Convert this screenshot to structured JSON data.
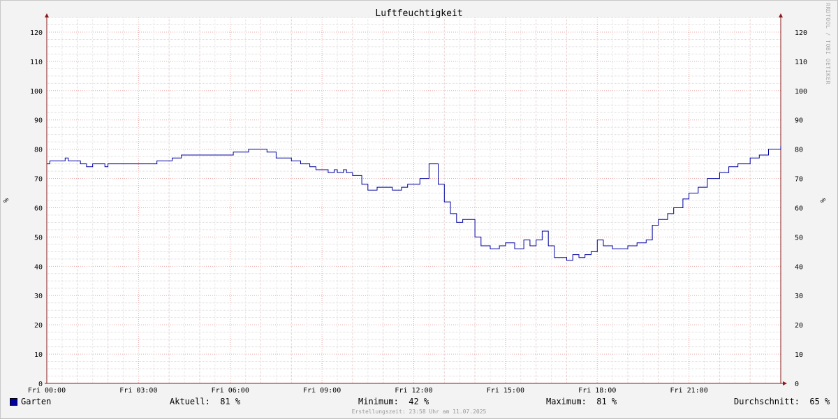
{
  "chart_data": {
    "type": "line",
    "title": "Luftfeuchtigkeit",
    "ylabel": "%",
    "ylabel_right": "%",
    "ylim": [
      0,
      125
    ],
    "y_ticks": [
      0,
      10,
      20,
      30,
      40,
      50,
      60,
      70,
      80,
      90,
      100,
      110,
      120
    ],
    "x_ticks": [
      "Fri 00:00",
      "Fri 03:00",
      "Fri 06:00",
      "Fri 09:00",
      "Fri 12:00",
      "Fri 15:00",
      "Fri 18:00",
      "Fri 21:00"
    ],
    "x_unit": "hours",
    "xlim": [
      0,
      24
    ],
    "grid": true,
    "series": [
      {
        "name": "Garten",
        "color": "#0000a0",
        "x": [
          0,
          0.1,
          0.5,
          0.6,
          0.7,
          1.0,
          1.1,
          1.3,
          1.5,
          1.9,
          2.0,
          2.3,
          2.9,
          3.6,
          4.1,
          4.4,
          5.0,
          6.1,
          6.6,
          6.9,
          7.2,
          7.5,
          8.0,
          8.3,
          8.6,
          8.8,
          9.1,
          9.2,
          9.4,
          9.5,
          9.7,
          9.8,
          10.0,
          10.3,
          10.5,
          10.8,
          11.0,
          11.3,
          11.6,
          11.8,
          12.0,
          12.2,
          12.5,
          12.8,
          13.0,
          13.2,
          13.4,
          13.6,
          14.0,
          14.2,
          14.5,
          14.8,
          15.0,
          15.3,
          15.6,
          15.8,
          16.0,
          16.2,
          16.4,
          16.6,
          17.0,
          17.2,
          17.4,
          17.6,
          17.8,
          18.0,
          18.2,
          18.5,
          18.8,
          19.0,
          19.3,
          19.6,
          19.8,
          20.0,
          20.3,
          20.5,
          20.8,
          21.0,
          21.3,
          21.6,
          22.0,
          22.3,
          22.6,
          23.0,
          23.3,
          23.6,
          24.0
        ],
        "values": [
          75,
          76,
          76,
          77,
          76,
          76,
          75,
          74,
          75,
          74,
          75,
          75,
          75,
          76,
          77,
          78,
          78,
          79,
          80,
          80,
          79,
          77,
          76,
          75,
          74,
          73,
          73,
          72,
          73,
          72,
          73,
          72,
          71,
          68,
          66,
          67,
          67,
          66,
          67,
          68,
          68,
          70,
          75,
          68,
          62,
          58,
          55,
          56,
          50,
          47,
          46,
          47,
          48,
          46,
          49,
          47,
          49,
          52,
          47,
          43,
          42,
          44,
          43,
          44,
          45,
          49,
          47,
          46,
          46,
          47,
          48,
          49,
          54,
          56,
          58,
          60,
          63,
          65,
          67,
          70,
          72,
          74,
          75,
          77,
          78,
          80,
          81
        ]
      }
    ]
  },
  "legend": {
    "series_name": "Garten",
    "current_label": "Aktuell:",
    "current_value": "81 %",
    "min_label": "Minimum:",
    "min_value": "42 %",
    "max_label": "Maximum:",
    "max_value": "81 %",
    "avg_label": "Durchschnitt:",
    "avg_value": "65 %"
  },
  "credit": "Erstellungszeit: 23:58 Uhr am 11.07.2025",
  "watermark": "RRDTOOL / TOBI OETIKER"
}
